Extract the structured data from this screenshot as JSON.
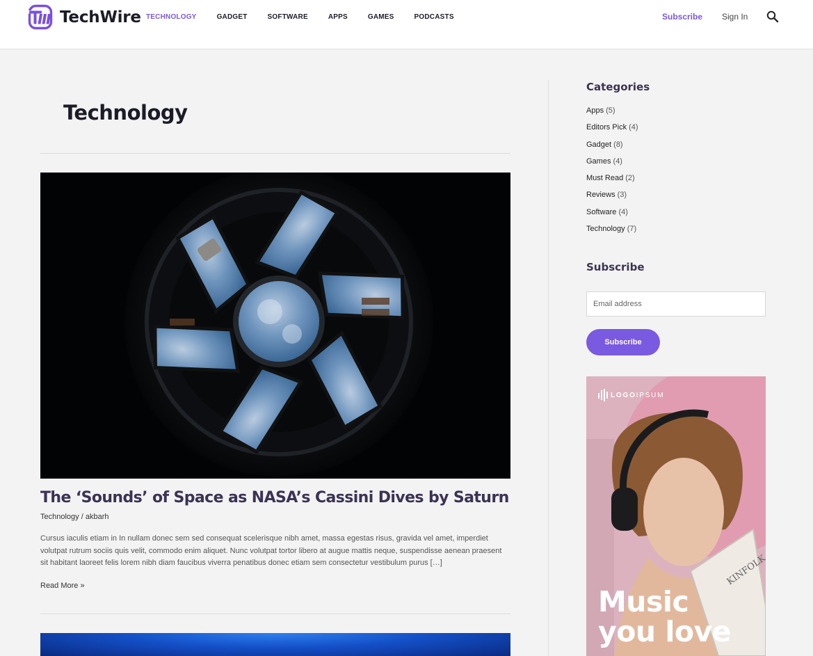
{
  "header": {
    "brand": "TechWire",
    "nav": [
      {
        "label": "TECHNOLOGY",
        "active": true
      },
      {
        "label": "GADGET",
        "active": false
      },
      {
        "label": "SOFTWARE",
        "active": false
      },
      {
        "label": "APPS",
        "active": false
      },
      {
        "label": "GAMES",
        "active": false
      },
      {
        "label": "PODCASTS",
        "active": false
      }
    ],
    "subscribe_label": "Subscribe",
    "signin_label": "Sign In",
    "search_icon": "search-icon"
  },
  "main": {
    "page_title": "Technology",
    "post": {
      "title": "The ‘Sounds’ of Space as NASA’s Cassini Dives by Saturn",
      "category": "Technology",
      "separator": "/",
      "author": "akbarh",
      "excerpt": "Cursus iaculis etiam in In nullam donec sem sed consequat scelerisque nibh amet, massa egestas risus, gravida vel amet, imperdiet volutpat rutrum sociis quis velit, commodo enim aliquet. Nunc volutpat tortor libero at augue mattis neque, suspendisse aenean praesent sit habitant laoreet felis lorem nibh diam faucibus viverra penatibus donec etiam sem consectetur vestibulum purus […]",
      "read_more": "Read More »"
    }
  },
  "sidebar": {
    "categories_title": "Categories",
    "categories": [
      {
        "name": "Apps",
        "count": "(5)"
      },
      {
        "name": "Editors Pick",
        "count": "(4)"
      },
      {
        "name": "Gadget",
        "count": "(8)"
      },
      {
        "name": "Games",
        "count": "(4)"
      },
      {
        "name": "Must Read",
        "count": "(2)"
      },
      {
        "name": "Reviews",
        "count": "(3)"
      },
      {
        "name": "Software",
        "count": "(4)"
      },
      {
        "name": "Technology",
        "count": "(7)"
      }
    ],
    "subscribe_title": "Subscribe",
    "email_placeholder": "Email address",
    "subscribe_button": "Subscribe",
    "ad": {
      "logo_bold": "LOGO",
      "logo_rest": "IPSUM",
      "headline_line1": "Music",
      "headline_line2": "you love"
    }
  },
  "colors": {
    "accent": "#7a5ae0",
    "heading": "#3b3354",
    "page_bg": "#f3f3f3"
  }
}
